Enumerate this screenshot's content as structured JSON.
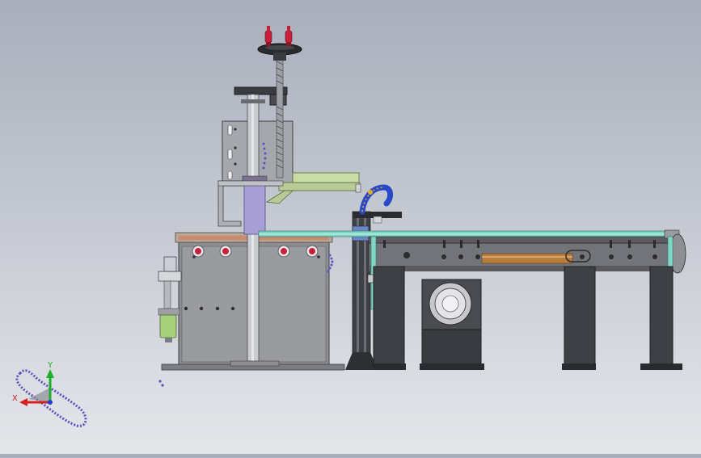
{
  "viewport": {
    "background_top": "#a8aebb",
    "background_bottom": "#e4e6ea"
  },
  "triad": {
    "x_label": "X",
    "y_label": "Y",
    "x_color": "#d62020",
    "y_color": "#1fae2a",
    "z_color": "#1f3fd6"
  },
  "colors": {
    "frame_gray": "#8e8f93",
    "dark_steel": "#4a4b50",
    "column": "#c9cbd0",
    "lavender": "#a79fd6",
    "green_arm": "#c9dca6",
    "conveyor_rail": "#7fd6c4",
    "knob_red": "#c8203a",
    "chain_purple": "#5a4fc0",
    "amber_band": "#b87c3c",
    "cylinder_green": "#a9d07a"
  }
}
